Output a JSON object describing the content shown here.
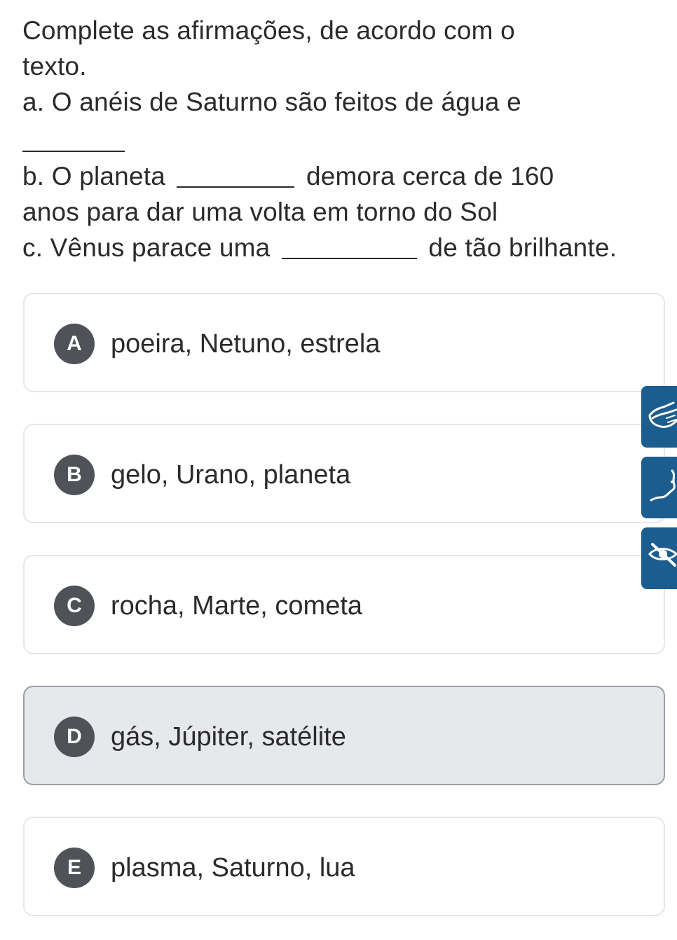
{
  "question": {
    "line1": "Complete as afirmações, de acordo com o",
    "line2": "texto.",
    "a_text": "a. O anéis de Saturno são feitos de água e",
    "b_before": "b. O planeta",
    "b_after": "demora cerca de 160",
    "b_line2": "anos para dar uma volta em torno do Sol",
    "c_before": "c. Vênus parace uma",
    "c_after": "de tão brilhante."
  },
  "options": [
    {
      "letter": "A",
      "text": "poeira, Netuno, estrela",
      "selected": false
    },
    {
      "letter": "B",
      "text": "gelo, Urano, planeta",
      "selected": false
    },
    {
      "letter": "C",
      "text": "rocha, Marte, cometa",
      "selected": false
    },
    {
      "letter": "D",
      "text": "gás, Júpiter, satélite",
      "selected": true
    },
    {
      "letter": "E",
      "text": "plasma, Saturno, lua",
      "selected": false
    }
  ],
  "accessibility_buttons": [
    {
      "icon": "sign-language-hands-icon"
    },
    {
      "icon": "sign-language-person-icon"
    },
    {
      "icon": "hide-eye-icon"
    }
  ],
  "colors": {
    "badge": "#4f5258",
    "selected_bg": "#e6e8ec",
    "accessibility_bg": "#1c5d8f"
  }
}
